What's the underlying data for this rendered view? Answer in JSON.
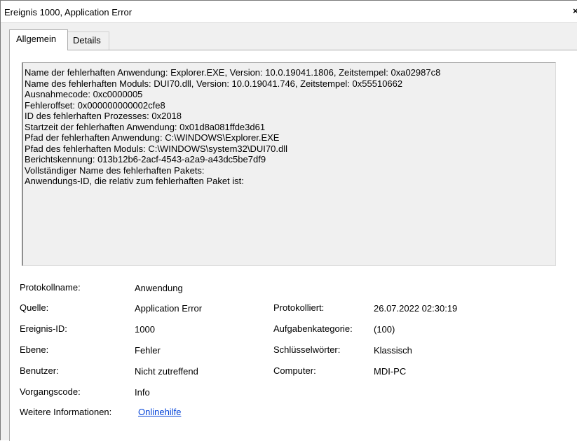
{
  "window": {
    "title": "Ereignis 1000, Application Error",
    "close_glyph": "×"
  },
  "tabs": [
    {
      "label": "Allgemein"
    },
    {
      "label": "Details"
    }
  ],
  "description": [
    "Name der fehlerhaften Anwendung: Explorer.EXE, Version: 10.0.19041.1806, Zeitstempel: 0xa02987c8",
    "Name des fehlerhaften Moduls: DUI70.dll, Version: 10.0.19041.746, Zeitstempel: 0x55510662",
    "Ausnahmecode: 0xc0000005",
    "Fehleroffset: 0x000000000002cfe8",
    "ID des fehlerhaften Prozesses: 0x2018",
    "Startzeit der fehlerhaften Anwendung: 0x01d8a081ffde3d61",
    "Pfad der fehlerhaften Anwendung: C:\\WINDOWS\\Explorer.EXE",
    "Pfad des fehlerhaften Moduls: C:\\WINDOWS\\system32\\DUI70.dll",
    "Berichtskennung: 013b12b6-2acf-4543-a2a9-a43dc5be7df9",
    "Vollständiger Name des fehlerhaften Pakets:",
    "Anwendungs-ID, die relativ zum fehlerhaften Paket ist:"
  ],
  "fields": {
    "protokollname": {
      "label": "Protokollname:",
      "value": "Anwendung"
    },
    "quelle": {
      "label": "Quelle:",
      "value": "Application Error"
    },
    "ereignis_id": {
      "label": "Ereignis-ID:",
      "value": "1000"
    },
    "ebene": {
      "label": "Ebene:",
      "value": "Fehler"
    },
    "benutzer": {
      "label": "Benutzer:",
      "value": "Nicht zutreffend"
    },
    "vorgangscode": {
      "label": "Vorgangscode:",
      "value": "Info"
    },
    "weitere_informationen": {
      "label": "Weitere Informationen:",
      "value": "Onlinehilfe"
    },
    "protokolliert": {
      "label": "Protokolliert:",
      "value": "26.07.2022 02:30:19"
    },
    "aufgabenkategorie": {
      "label": "Aufgabenkategorie:",
      "value": "(100)"
    },
    "schluesselwoerter": {
      "label": "Schlüsselwörter:",
      "value": "Klassisch"
    },
    "computer": {
      "label": "Computer:",
      "value": "MDI-PC"
    }
  }
}
